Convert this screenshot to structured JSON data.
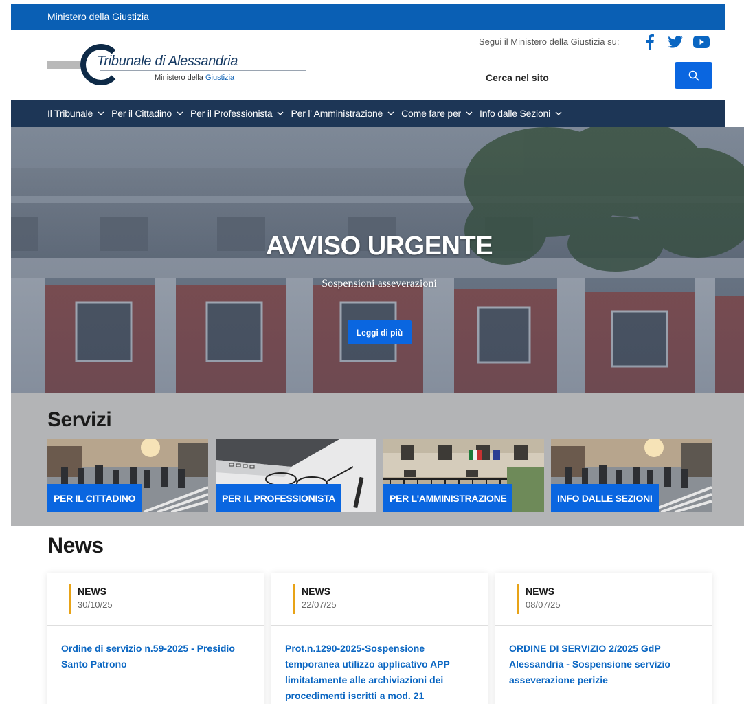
{
  "topbar": {
    "label": "Ministero della Giustizia"
  },
  "header": {
    "logo_title": "Tribunale di Alessandria",
    "logo_subtitle_prefix": "Ministero della ",
    "logo_subtitle_accent": "Giustizia",
    "social_label": "Segui il Ministero della Giustizia su:",
    "social_icons": [
      "facebook-icon",
      "twitter-icon",
      "youtube-icon"
    ],
    "search": {
      "placeholder": "Cerca nel sito",
      "button_icon": "search-icon"
    }
  },
  "nav": {
    "items": [
      {
        "label": "Il Tribunale"
      },
      {
        "label": "Per il Cittadino"
      },
      {
        "label": "Per il Professionista"
      },
      {
        "label": "Per l' Amministrazione"
      },
      {
        "label": "Come fare per"
      },
      {
        "label": "Info dalle Sezioni"
      }
    ]
  },
  "hero": {
    "title": "AVVISO URGENTE",
    "subtitle": "Sospensioni asseverazioni",
    "button_label": "Leggi di più"
  },
  "servizi": {
    "title": "Servizi",
    "cards": [
      {
        "label": "PER IL CITTADINO"
      },
      {
        "label": "PER IL PROFESSIONISTA"
      },
      {
        "label": "PER L'AMMINISTRAZIONE"
      },
      {
        "label": "INFO DALLE SEZIONI"
      }
    ]
  },
  "news": {
    "title": "News",
    "items": [
      {
        "category": "NEWS",
        "date": "30/10/25",
        "title": "Ordine di servizio n.59-2025 - Presidio Santo Patrono"
      },
      {
        "category": "NEWS",
        "date": "22/07/25",
        "title": "Prot.n.1290-2025-Sospensione temporanea utilizzo applicativo APP limitatamente alle archiviazioni dei procedimenti iscritti a mod. 21"
      },
      {
        "category": "NEWS",
        "date": "08/07/25",
        "title": "ORDINE DI SERVIZIO 2/2025 GdP Alessandria - Sospensione servizio asseverazione perizie"
      }
    ]
  },
  "colors": {
    "primary_blue": "#0a66e0",
    "topbar_blue": "#0a5fb4",
    "nav_navy": "#1d3656",
    "accent_orange": "#e8a317",
    "servizi_gray": "#b3b4b6"
  }
}
